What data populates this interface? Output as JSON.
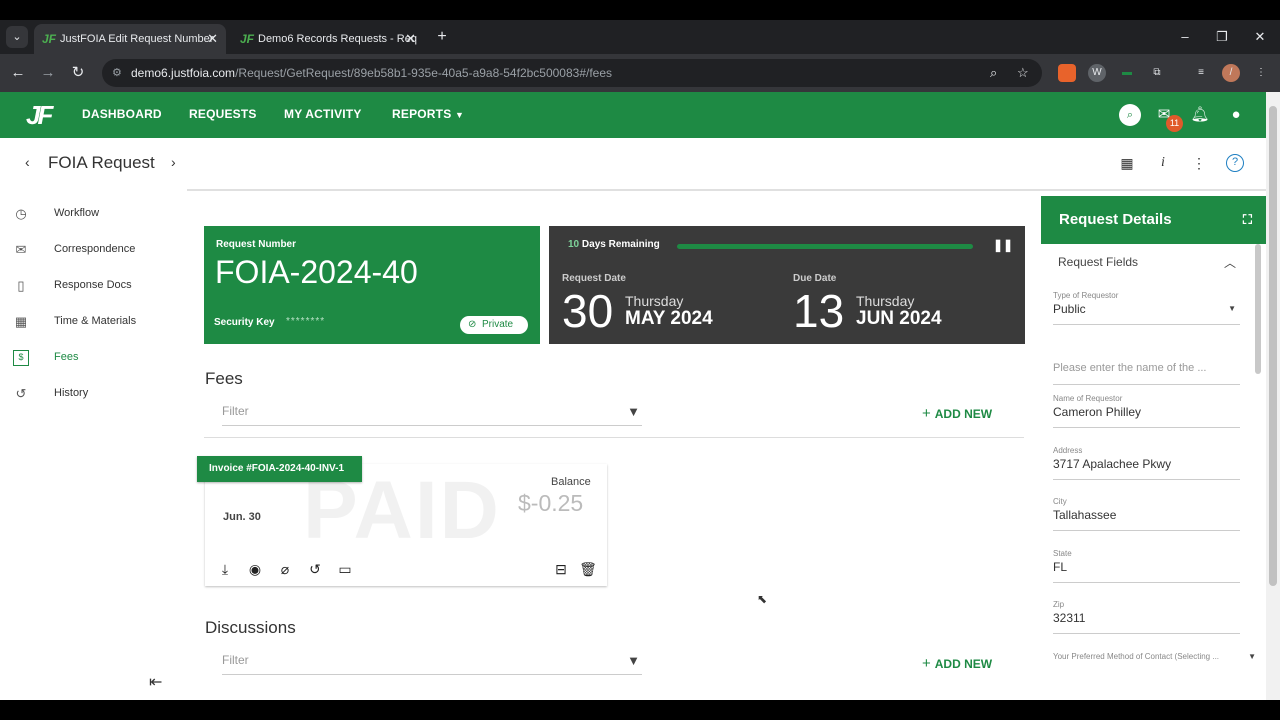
{
  "browser": {
    "tabs": [
      {
        "title": "JustFOIA Edit Request Number",
        "active": true
      },
      {
        "title": "Demo6 Records Requests - Req",
        "active": false
      }
    ],
    "url_host": "demo6.justfoia.com",
    "url_path": "/Request/GetRequest/89eb58b1-935e-40a5-a9a8-54f2bc500083#/fees"
  },
  "nav": {
    "logo": "JF",
    "links": [
      "DASHBOARD",
      "REQUESTS",
      "MY ACTIVITY",
      "REPORTS"
    ],
    "mail_badge": "11"
  },
  "page": {
    "title": "FOIA Request"
  },
  "sidebar": {
    "items": [
      {
        "label": "Workflow",
        "icon": "clock-icon"
      },
      {
        "label": "Correspondence",
        "icon": "mail-icon"
      },
      {
        "label": "Response Docs",
        "icon": "document-icon"
      },
      {
        "label": "Time & Materials",
        "icon": "calculator-icon"
      },
      {
        "label": "Fees",
        "icon": "dollar-icon",
        "active": true
      },
      {
        "label": "History",
        "icon": "history-icon"
      }
    ]
  },
  "request": {
    "number_label": "Request Number",
    "number": "FOIA-2024-40",
    "security_key_label": "Security Key",
    "security_key": "********",
    "private_label": "Private",
    "days_remaining_num": "10",
    "days_remaining_text": "Days Remaining",
    "days_progress": 1.0,
    "request_date_label": "Request Date",
    "request_day": "30",
    "request_weekday": "Thursday",
    "request_monthyear": "MAY 2024",
    "due_date_label": "Due Date",
    "due_day": "13",
    "due_weekday": "Thursday",
    "due_monthyear": "JUN 2024"
  },
  "fees": {
    "title": "Fees",
    "filter_placeholder": "Filter",
    "add_new": "ADD NEW",
    "invoice": {
      "tag": "Invoice #FOIA-2024-40-INV-1",
      "watermark": "PAID",
      "date": "Jun. 30",
      "balance_label": "Balance",
      "balance": "$-0.25"
    }
  },
  "discussions": {
    "title": "Discussions",
    "filter_placeholder": "Filter",
    "add_new": "ADD NEW"
  },
  "details": {
    "title": "Request Details",
    "section": "Request Fields",
    "fields": [
      {
        "label": "Type of Requestor",
        "value": "Public"
      },
      {
        "label": "",
        "placeholder": "Please enter the name of the ..."
      },
      {
        "label": "Name of Requestor",
        "value": "Cameron Philley"
      },
      {
        "label": "Address",
        "value": "3717 Apalachee Pkwy"
      },
      {
        "label": "City",
        "value": "Tallahassee"
      },
      {
        "label": "State",
        "value": "FL"
      },
      {
        "label": "Zip",
        "value": "32311"
      },
      {
        "label": "Your Preferred Method of Contact (Selecting ...",
        "value": ""
      }
    ]
  }
}
